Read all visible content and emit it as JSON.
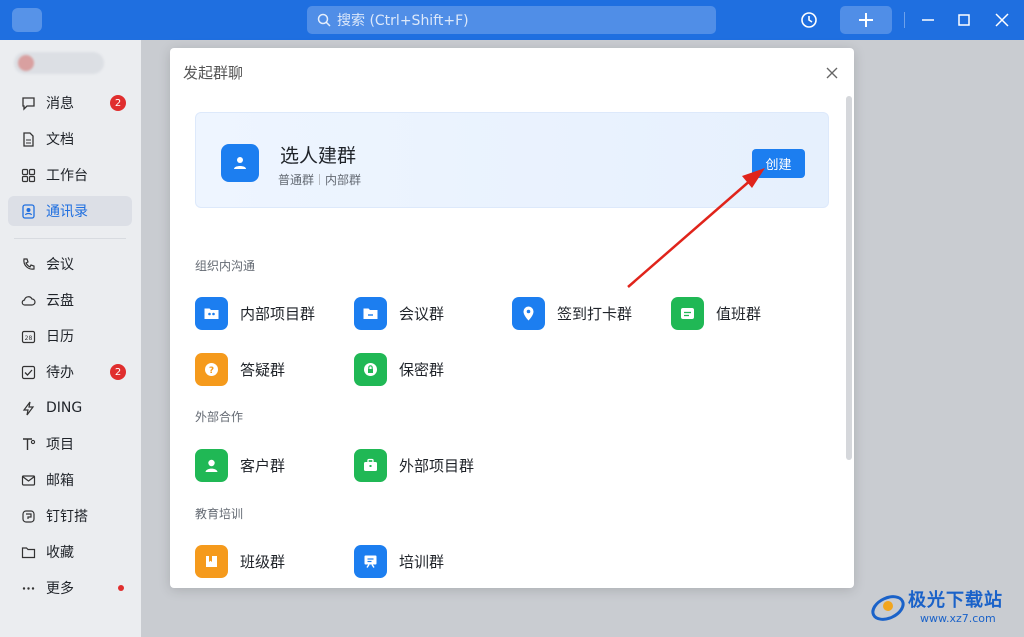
{
  "topbar": {
    "search_placeholder": "搜索 (Ctrl+Shift+F)"
  },
  "sidebar": {
    "items": [
      {
        "label": "消息",
        "icon": "chat-icon",
        "badge": "2"
      },
      {
        "label": "文档",
        "icon": "document-icon"
      },
      {
        "label": "工作台",
        "icon": "grid-icon"
      },
      {
        "label": "通讯录",
        "icon": "contacts-icon",
        "active": true
      },
      {
        "label": "会议",
        "icon": "phone-icon"
      },
      {
        "label": "云盘",
        "icon": "cloud-icon"
      },
      {
        "label": "日历",
        "icon": "calendar-icon",
        "icon_text": "28"
      },
      {
        "label": "待办",
        "icon": "todo-icon",
        "badge": "2"
      },
      {
        "label": "DING",
        "icon": "lightning-icon"
      },
      {
        "label": "项目",
        "icon": "project-icon"
      },
      {
        "label": "邮箱",
        "icon": "mail-icon"
      },
      {
        "label": "钉钉搭",
        "icon": "builder-icon"
      },
      {
        "label": "收藏",
        "icon": "folder-icon"
      },
      {
        "label": "更多",
        "icon": "more-icon",
        "dot": true
      }
    ]
  },
  "dialog": {
    "title": "发起群聊",
    "create_card": {
      "title": "选人建群",
      "sub_1": "普通群",
      "sub_2": "内部群",
      "button": "创建"
    },
    "sections": [
      {
        "title": "组织内沟通",
        "items": [
          {
            "label": "内部项目群",
            "color": "#1c7ef0",
            "icon": "folder-people-icon"
          },
          {
            "label": "会议群",
            "color": "#1c7ef0",
            "icon": "folder-icon"
          },
          {
            "label": "签到打卡群",
            "color": "#1c7ef0",
            "icon": "location-pin-icon"
          },
          {
            "label": "值班群",
            "color": "#20b855",
            "icon": "calendar-duty-icon"
          },
          {
            "label": "答疑群",
            "color": "#f59a1c",
            "icon": "question-icon"
          },
          {
            "label": "保密群",
            "color": "#20b855",
            "icon": "lock-bubble-icon"
          }
        ]
      },
      {
        "title": "外部合作",
        "items": [
          {
            "label": "客户群",
            "color": "#20b855",
            "icon": "customer-icon"
          },
          {
            "label": "外部项目群",
            "color": "#20b855",
            "icon": "briefcase-icon"
          }
        ]
      },
      {
        "title": "教育培训",
        "items": [
          {
            "label": "班级群",
            "color": "#f59a1c",
            "icon": "class-book-icon"
          },
          {
            "label": "培训群",
            "color": "#1c7ef0",
            "icon": "training-board-icon"
          }
        ]
      }
    ]
  },
  "watermark": {
    "text": "极光下载站",
    "url": "www.xz7.com"
  }
}
